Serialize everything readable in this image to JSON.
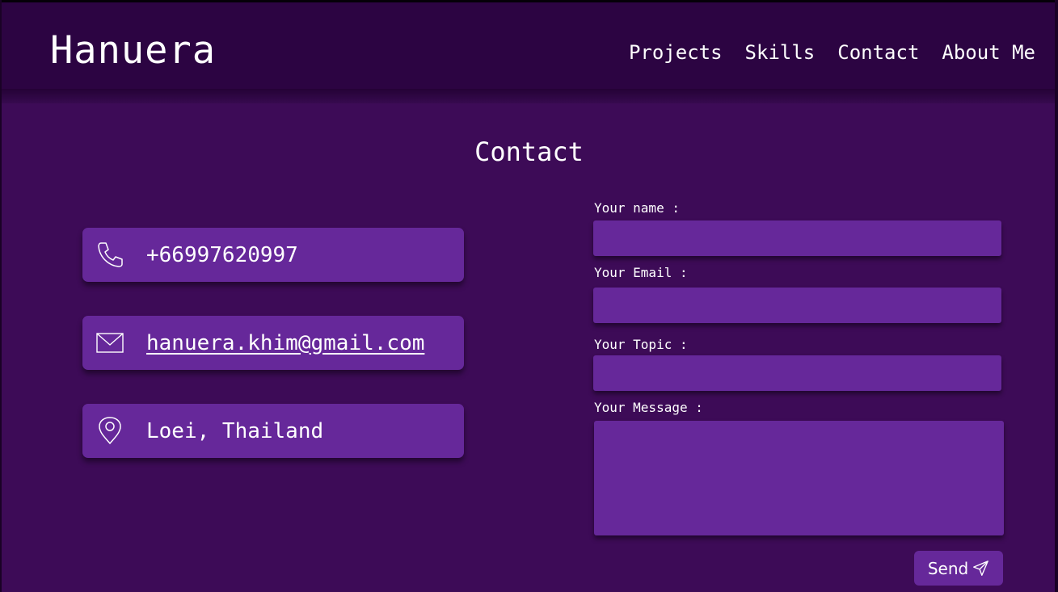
{
  "header": {
    "brand": "Hanuera",
    "nav": [
      "Projects",
      "Skills",
      "Contact",
      "About Me"
    ]
  },
  "page": {
    "title": "Contact"
  },
  "contact_cards": [
    {
      "icon": "phone-icon",
      "text": "+66997620997"
    },
    {
      "icon": "mail-icon",
      "text": "hanuera.khim@gmail.com"
    },
    {
      "icon": "location-pin-icon",
      "text": "Loei, Thailand"
    }
  ],
  "form": {
    "name_label": "Your name :",
    "email_label": "Your Email :",
    "topic_label": "Your Topic :",
    "message_label": "Your Message :",
    "name_value": "",
    "email_value": "",
    "topic_value": "",
    "message_value": "",
    "send_label": "Send",
    "send_icon": "send-icon"
  },
  "colors": {
    "background": "#3d0b57",
    "header": "#2c0442",
    "card": "#66289a",
    "text": "#ffffff"
  }
}
